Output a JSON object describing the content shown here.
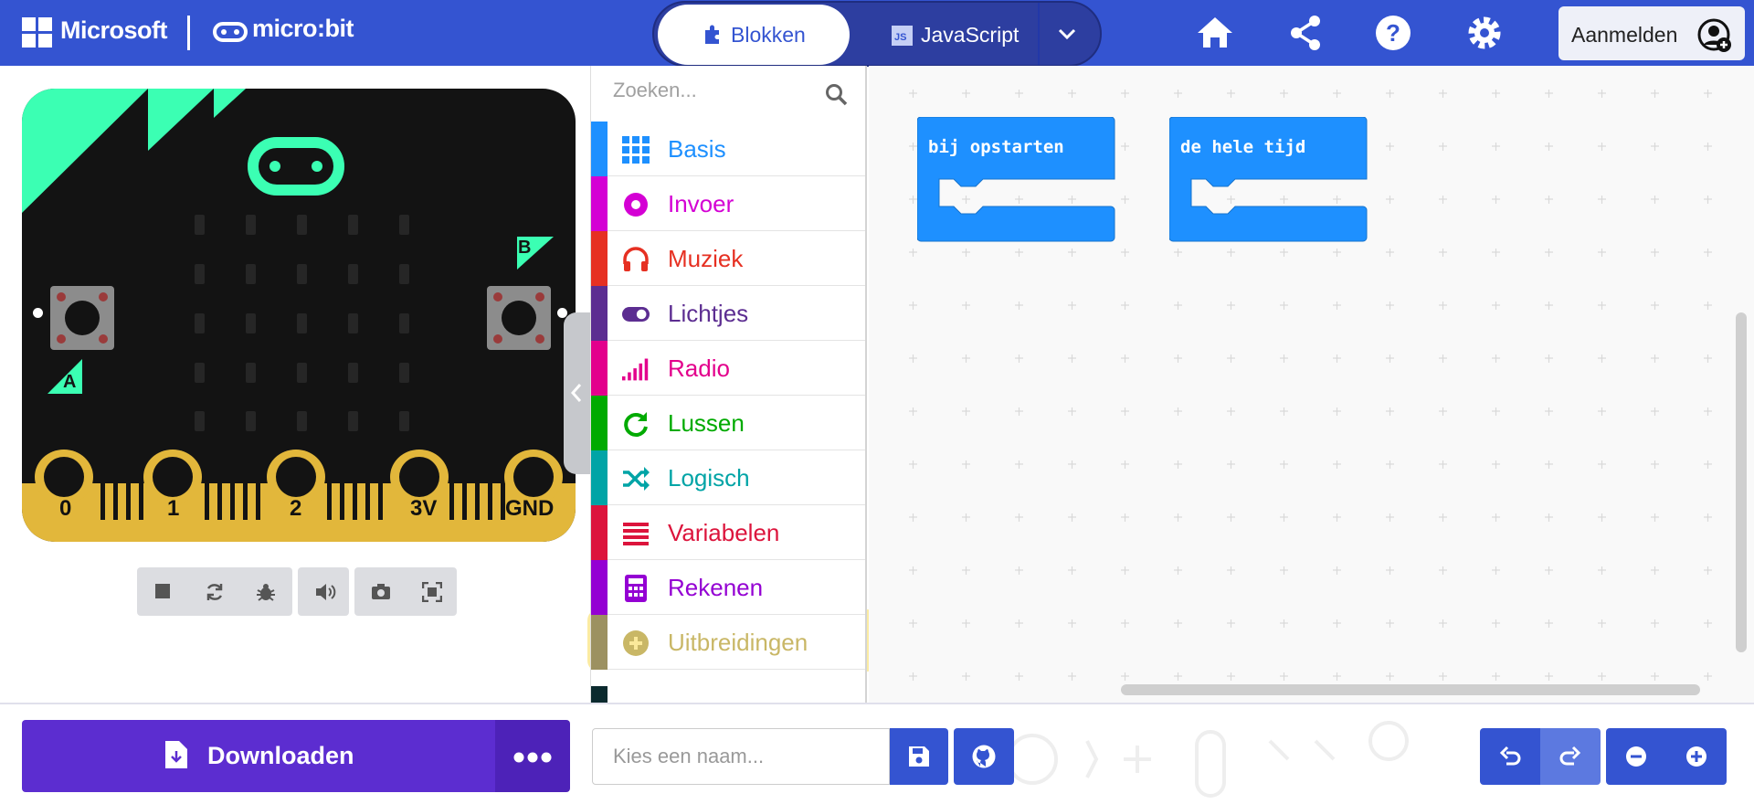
{
  "header": {
    "brand_microsoft": "Microsoft",
    "brand_microbit": "micro:bit",
    "mode_blocks_label": "Blokken",
    "mode_js_label": "JavaScript",
    "mode_js_badge": "JS",
    "signin_label": "Aanmelden",
    "icons": [
      "home-icon",
      "share-icon",
      "help-icon",
      "settings-icon",
      "signin-avatar-icon"
    ],
    "bar_color": "#3454d1"
  },
  "simulator": {
    "pins": [
      "0",
      "1",
      "2",
      "3V",
      "GND"
    ],
    "button_a": "A",
    "button_b": "B",
    "toolbar_icons": [
      "stop-icon",
      "restart-icon",
      "debug-icon",
      "mute-icon",
      "screenshot-icon",
      "fullscreen-icon"
    ]
  },
  "toolbox": {
    "search_placeholder": "Zoeken...",
    "categories": [
      {
        "label": "Basis",
        "color": "#1e90ff",
        "icon": "grid-icon"
      },
      {
        "label": "Invoer",
        "color": "#d400d4",
        "icon": "record-icon"
      },
      {
        "label": "Muziek",
        "color": "#e63022",
        "icon": "headphones-icon"
      },
      {
        "label": "Lichtjes",
        "color": "#5c2d91",
        "icon": "toggle-icon"
      },
      {
        "label": "Radio",
        "color": "#e3008c",
        "icon": "signal-icon"
      },
      {
        "label": "Lussen",
        "color": "#00aa00",
        "icon": "loop-icon"
      },
      {
        "label": "Logisch",
        "color": "#00a4a6",
        "icon": "shuffle-icon"
      },
      {
        "label": "Variabelen",
        "color": "#dc143c",
        "icon": "list-icon"
      },
      {
        "label": "Rekenen",
        "color": "#9400d3",
        "icon": "calculator-icon"
      },
      {
        "label": "Uitbreidingen",
        "color": "#c9b766",
        "icon": "plus-circle-icon"
      }
    ]
  },
  "workspace": {
    "blocks": [
      {
        "label": "bij opstarten"
      },
      {
        "label": "de hele tijd"
      }
    ],
    "block_color": "#1e90ff"
  },
  "footer": {
    "download_label": "Downloaden",
    "name_placeholder": "Kies een naam...",
    "accent": "#5c2dd0"
  }
}
